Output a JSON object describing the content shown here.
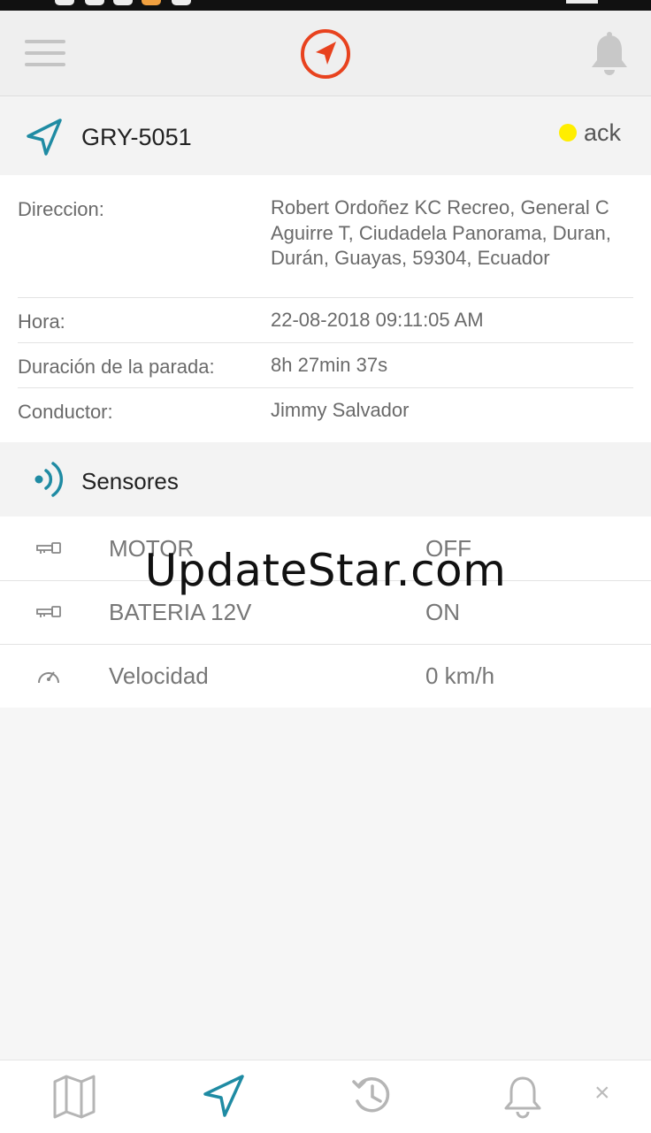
{
  "vehicle": {
    "name": "GRY-5051",
    "status_label": "ack",
    "status_color": "#ffee00"
  },
  "details": [
    {
      "label": "Direccion:",
      "value": "Robert Ordoñez KC Recreo, General C Aguirre T, Ciudadela Panorama, Duran, Durán, Guayas, 59304, Ecuador"
    },
    {
      "label": "Hora:",
      "value": "22-08-2018 09:11:05 AM"
    },
    {
      "label": "Duración de la parada:",
      "value": "8h 27min 37s"
    },
    {
      "label": "Conductor:",
      "value": "Jimmy Salvador"
    }
  ],
  "sensors": {
    "title": "Sensores",
    "items": [
      {
        "name": "MOTOR",
        "value": "OFF",
        "icon": "key-icon"
      },
      {
        "name": "BATERIA 12V",
        "value": "ON",
        "icon": "key-icon"
      },
      {
        "name": "Velocidad",
        "value": "0 km/h",
        "icon": "speedometer-icon"
      }
    ]
  },
  "watermark": "UpdateStar.com",
  "bottom_nav": {
    "close_label": "×"
  },
  "colors": {
    "accent_orange": "#e8421e",
    "accent_teal": "#1f8ba3"
  }
}
